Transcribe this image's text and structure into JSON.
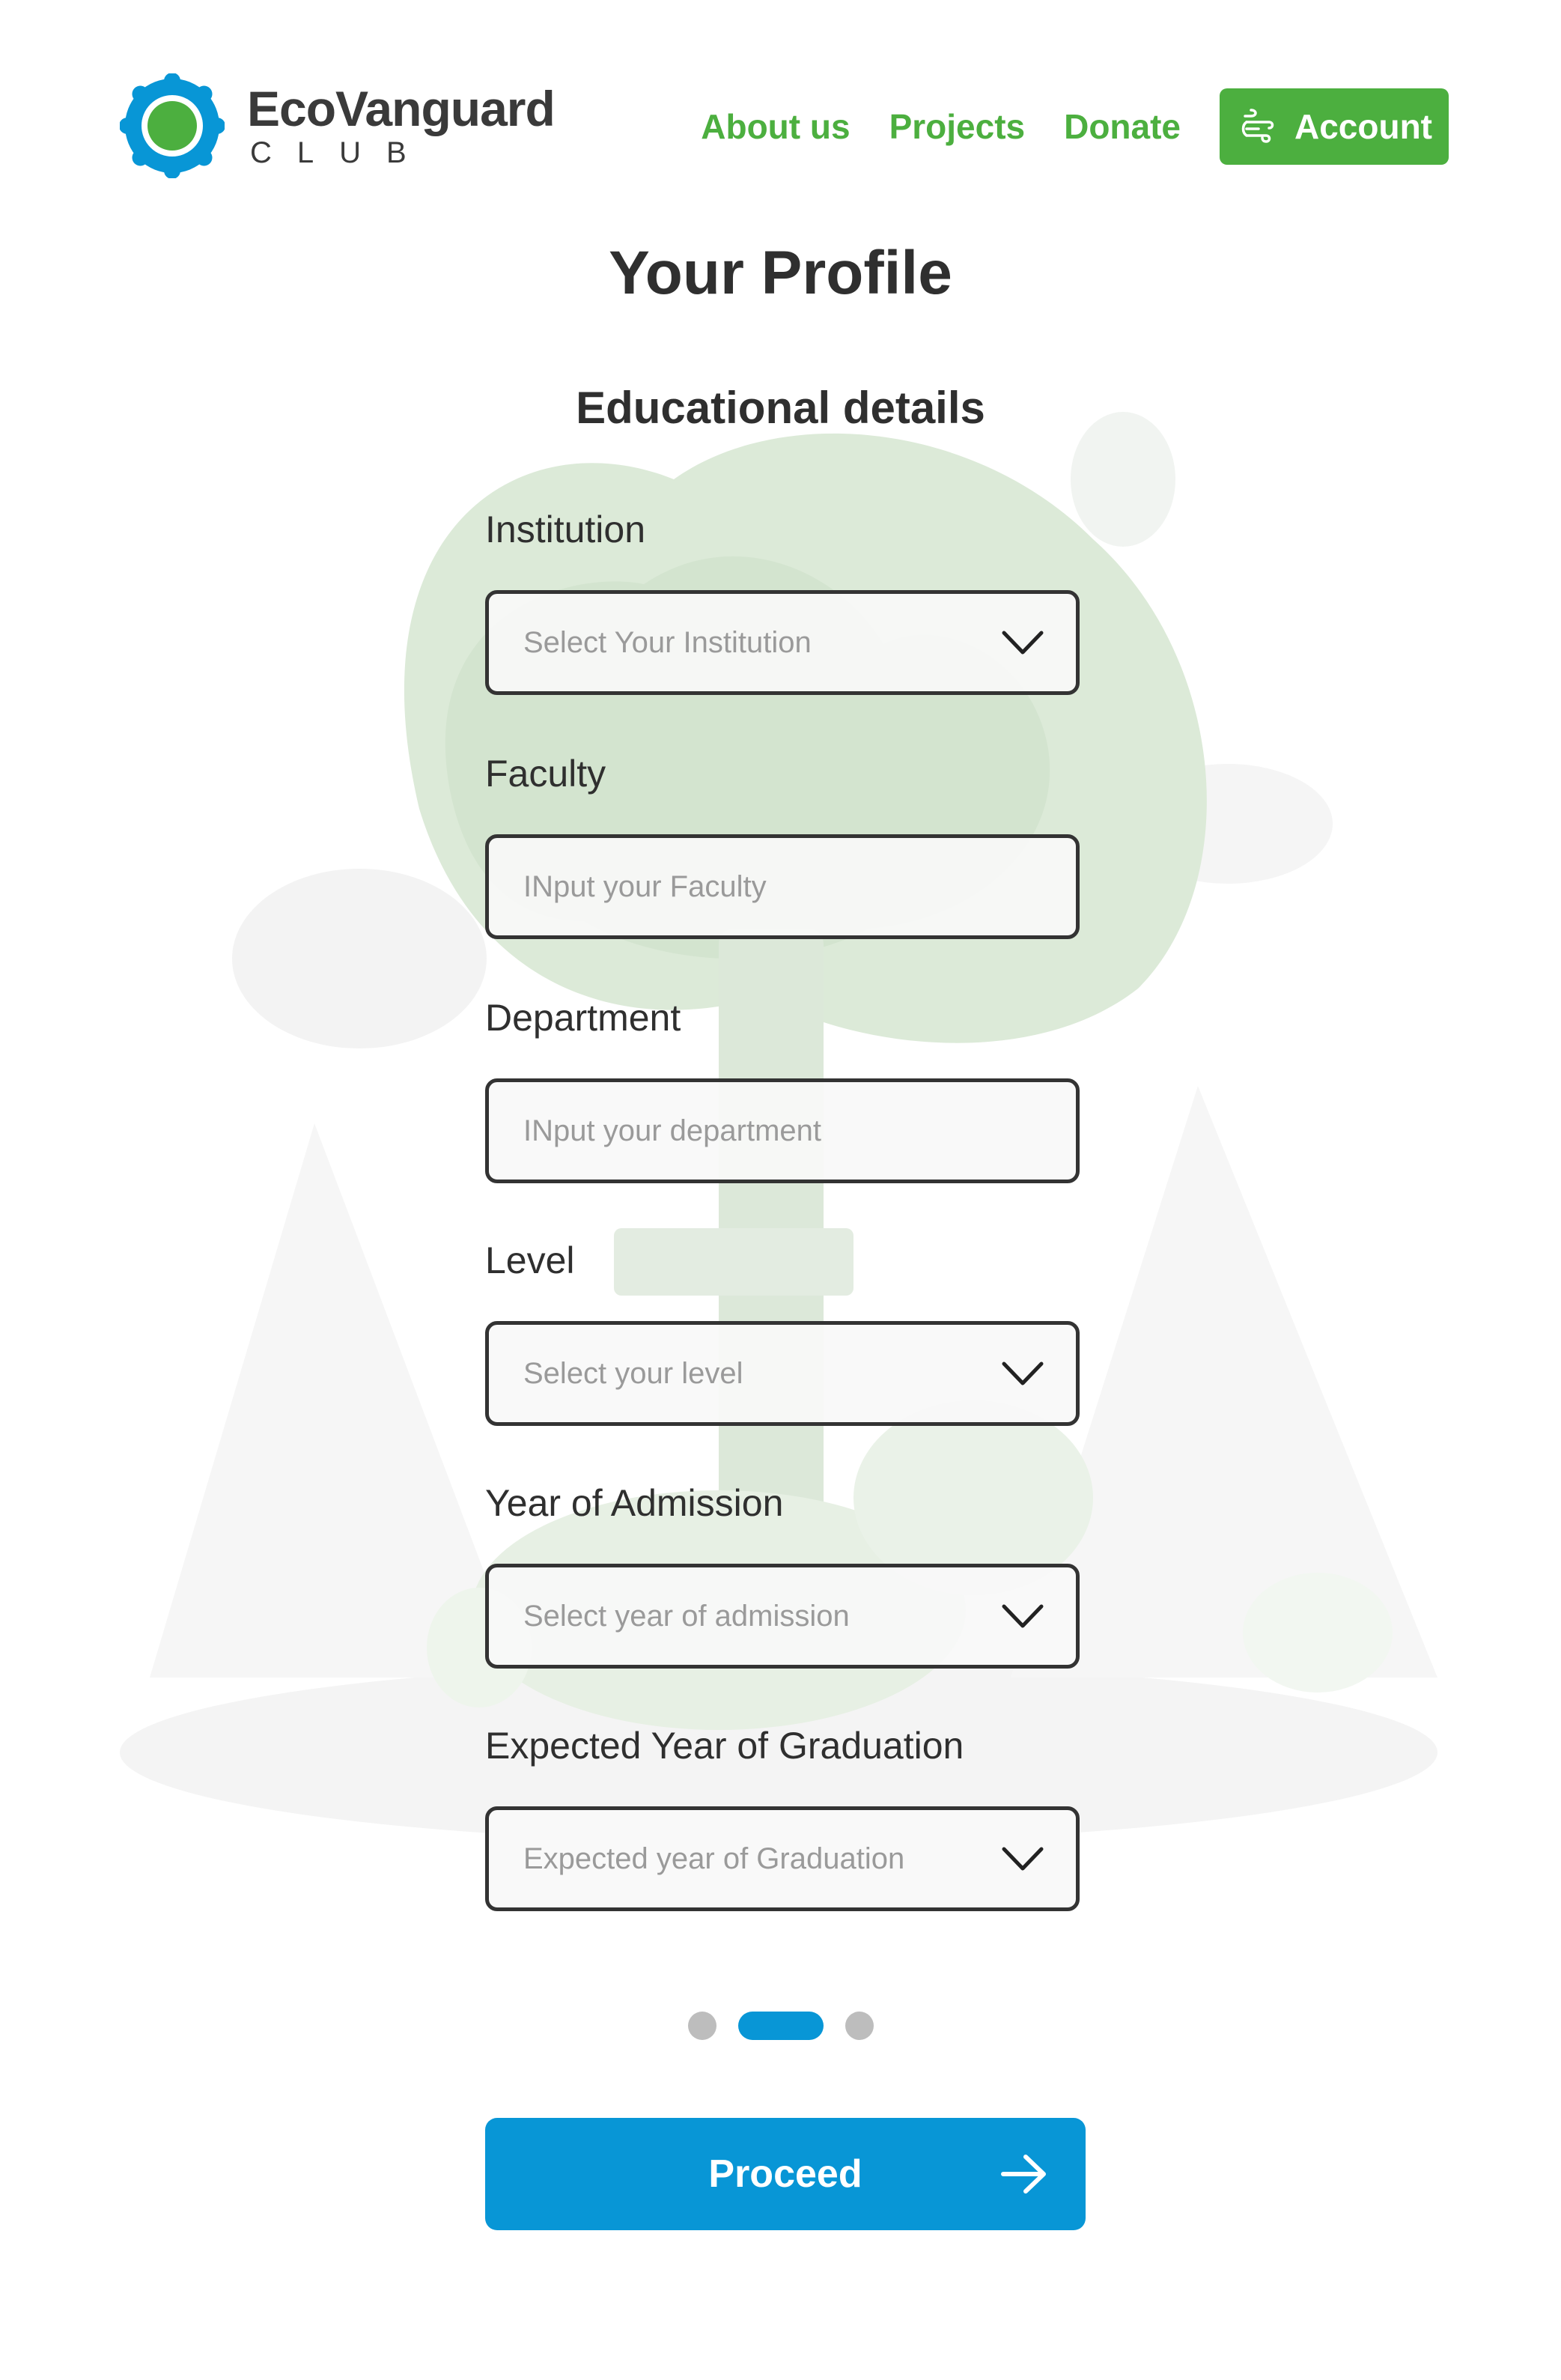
{
  "brand": {
    "name": "EcoVanguard",
    "sub": "CLUB",
    "colors": {
      "green": "#4caf3f",
      "blue": "#0896d6",
      "dark": "#333333"
    }
  },
  "nav": {
    "links": [
      "About us",
      "Projects",
      "Donate"
    ],
    "account_label": "Account",
    "account_icon": "user-wind-icon"
  },
  "page": {
    "title": "Your Profile",
    "section_title": "Educational details"
  },
  "form": {
    "fields": [
      {
        "label": "Institution",
        "placeholder": "Select Your Institution",
        "type": "select"
      },
      {
        "label": "Faculty",
        "placeholder": "INput your Faculty",
        "type": "input"
      },
      {
        "label": "Department",
        "placeholder": "INput your department",
        "type": "input"
      },
      {
        "label": "Level",
        "placeholder": "Select your level",
        "type": "select"
      },
      {
        "label": "Year of Admission",
        "placeholder": "Select year of admission",
        "type": "select"
      },
      {
        "label": "Expected Year of Graduation",
        "placeholder": "Expected year of Graduation",
        "type": "select"
      }
    ]
  },
  "pagination": {
    "total": 3,
    "active_step": 2
  },
  "actions": {
    "proceed_label": "Proceed",
    "proceed_icon": "arrow-right-icon"
  }
}
